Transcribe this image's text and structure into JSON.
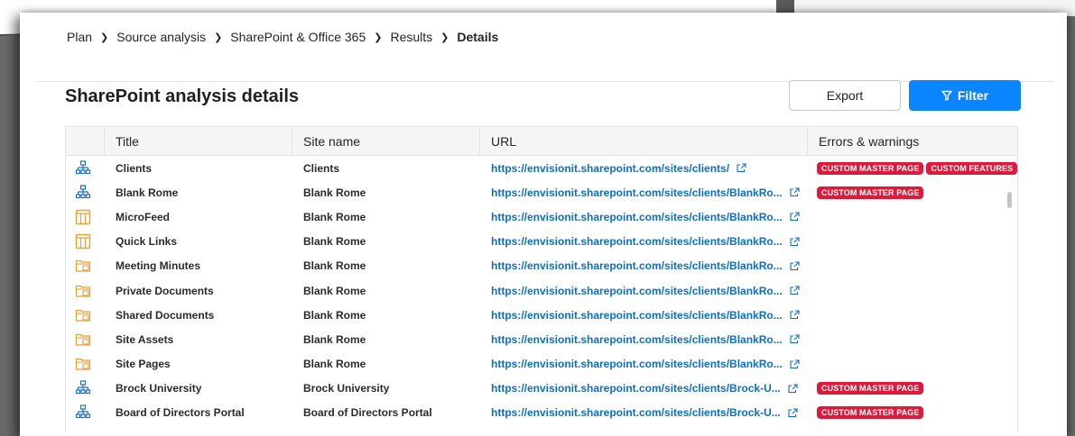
{
  "breadcrumb": {
    "items": [
      "Plan",
      "Source analysis",
      "SharePoint & Office 365",
      "Results",
      "Details"
    ],
    "separator": "›"
  },
  "page": {
    "title": "SharePoint analysis details"
  },
  "toolbar": {
    "export_label": "Export",
    "filter_label": "Filter"
  },
  "table": {
    "columns": [
      "",
      "Title",
      "Site name",
      "URL",
      "Errors & warnings"
    ],
    "rows": [
      {
        "icon": "site-icon",
        "title": "Clients",
        "site": "Clients",
        "url": "https://envisionit.sharepoint.com/sites/clients/",
        "badges": [
          "CUSTOM MASTER PAGE",
          "CUSTOM FEATURES"
        ]
      },
      {
        "icon": "site-icon",
        "title": "Blank Rome",
        "site": "Blank Rome",
        "url": "https://envisionit.sharepoint.com/sites/clients/BlankRo...",
        "badges": [
          "CUSTOM MASTER PAGE"
        ]
      },
      {
        "icon": "list-icon",
        "title": "MicroFeed",
        "site": "Blank Rome",
        "url": "https://envisionit.sharepoint.com/sites/clients/BlankRo...",
        "badges": []
      },
      {
        "icon": "list-icon",
        "title": "Quick Links",
        "site": "Blank Rome",
        "url": "https://envisionit.sharepoint.com/sites/clients/BlankRo...",
        "badges": []
      },
      {
        "icon": "library-icon",
        "title": "Meeting Minutes",
        "site": "Blank Rome",
        "url": "https://envisionit.sharepoint.com/sites/clients/BlankRo...",
        "badges": []
      },
      {
        "icon": "library-icon",
        "title": "Private Documents",
        "site": "Blank Rome",
        "url": "https://envisionit.sharepoint.com/sites/clients/BlankRo...",
        "badges": []
      },
      {
        "icon": "library-icon",
        "title": "Shared Documents",
        "site": "Blank Rome",
        "url": "https://envisionit.sharepoint.com/sites/clients/BlankRo...",
        "badges": []
      },
      {
        "icon": "library-icon",
        "title": "Site Assets",
        "site": "Blank Rome",
        "url": "https://envisionit.sharepoint.com/sites/clients/BlankRo...",
        "badges": []
      },
      {
        "icon": "library-icon",
        "title": "Site Pages",
        "site": "Blank Rome",
        "url": "https://envisionit.sharepoint.com/sites/clients/BlankRo...",
        "badges": []
      },
      {
        "icon": "site-icon",
        "title": "Brock University",
        "site": "Brock University",
        "url": "https://envisionit.sharepoint.com/sites/clients/Brock-U...",
        "badges": [
          "CUSTOM MASTER PAGE"
        ]
      },
      {
        "icon": "site-icon",
        "title": "Board of Directors Portal",
        "site": "Board of Directors Portal",
        "url": "https://envisionit.sharepoint.com/sites/clients/Brock-U...",
        "badges": [
          "CUSTOM MASTER PAGE"
        ]
      }
    ]
  },
  "colors": {
    "accent": "#0a84ff",
    "link": "#0a6ed1",
    "badge": "#e0193a",
    "site_icon": "#1f6fc5",
    "list_icon": "#e8a23a",
    "library_icon": "#e8a23a"
  }
}
